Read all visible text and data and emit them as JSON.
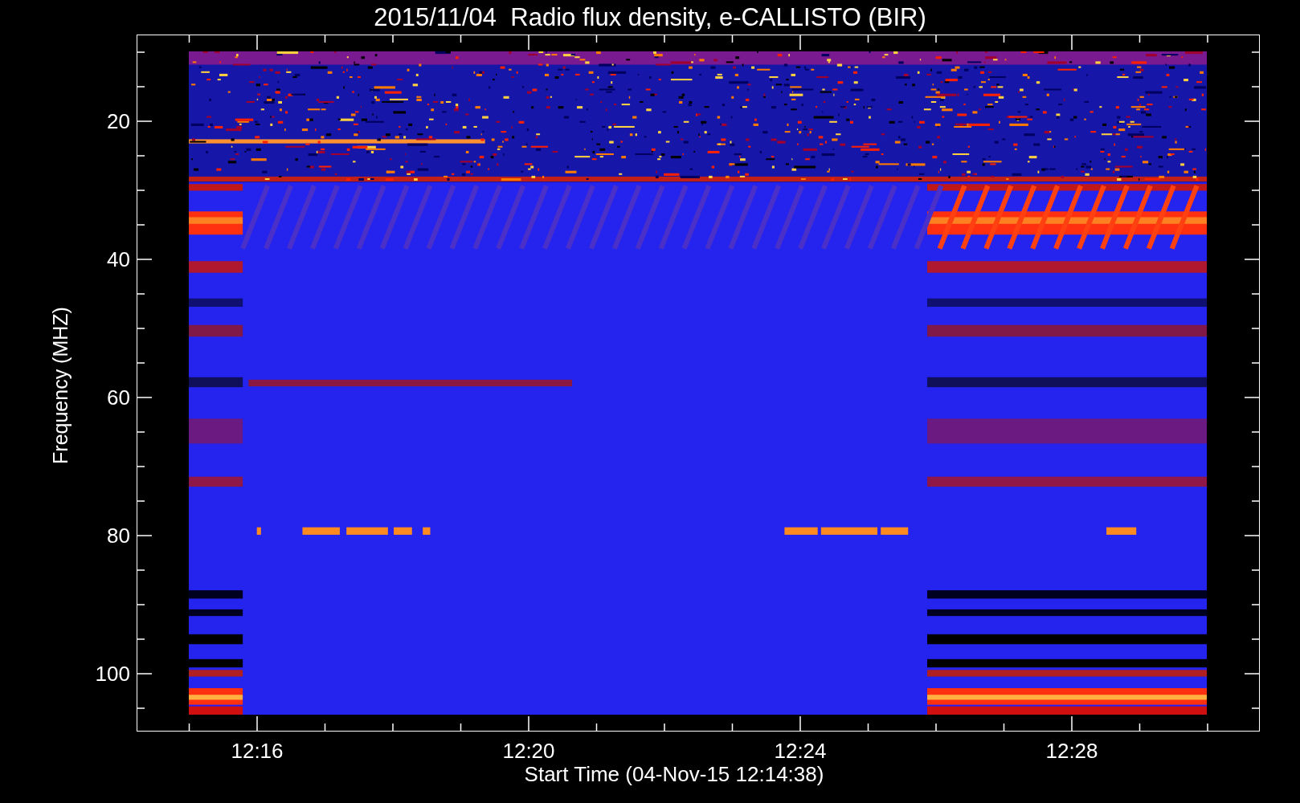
{
  "title": "2015/11/04  Radio flux density, e-CALLISTO (BIR)",
  "y_axis": {
    "label": "Frequency (MHZ)",
    "ticks": [
      "20",
      "40",
      "60",
      "80",
      "100"
    ]
  },
  "x_axis": {
    "label": "Start Time (04-Nov-15 12:14:38)",
    "ticks": [
      "12:16",
      "12:20",
      "12:24",
      "12:28"
    ]
  }
}
